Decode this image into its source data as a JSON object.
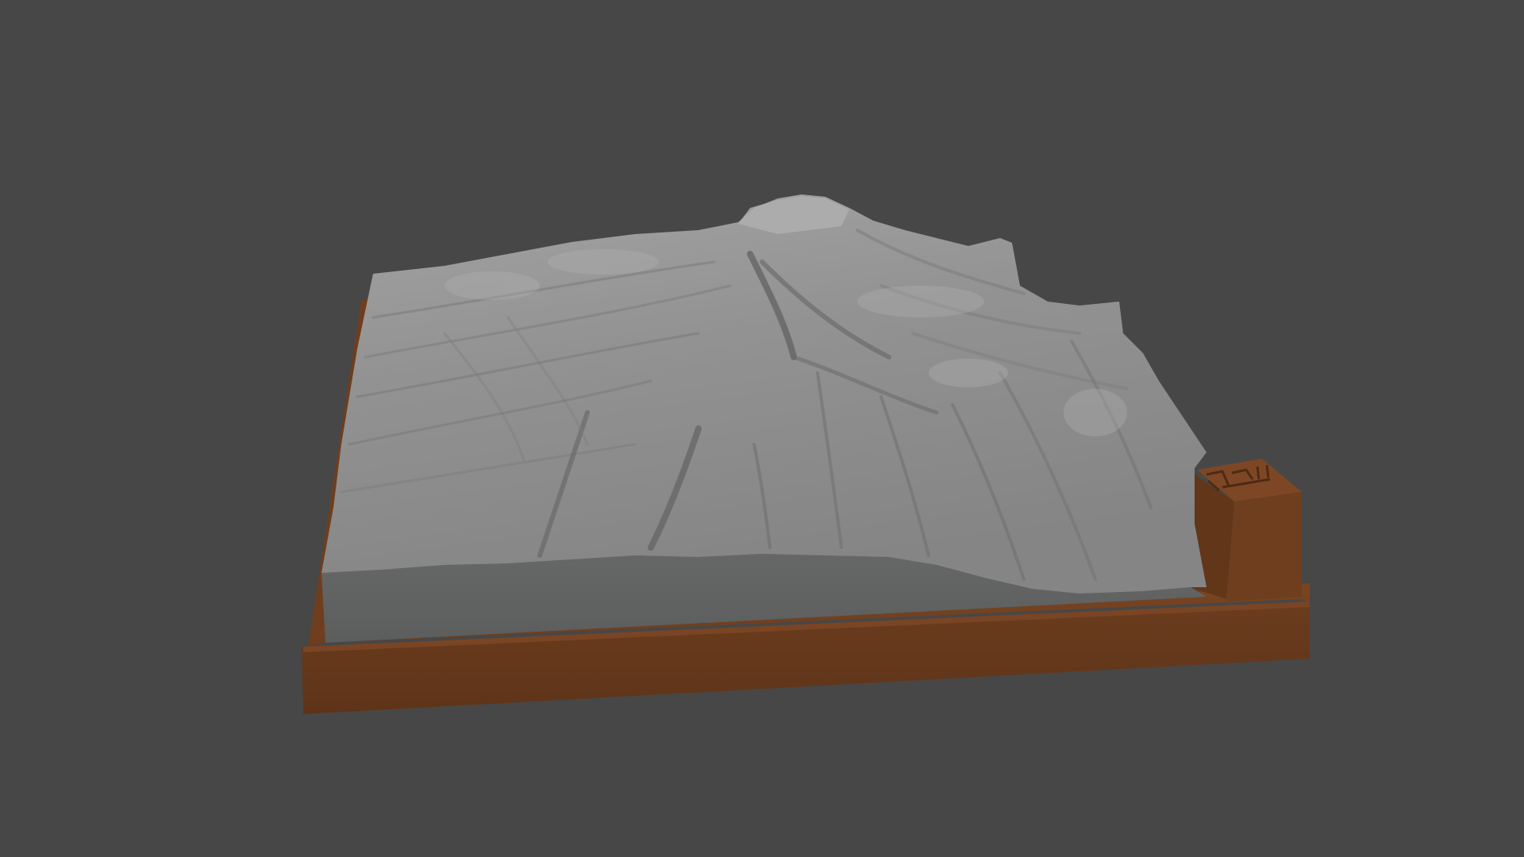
{
  "scene": {
    "background_color": "#474747",
    "model": {
      "name": "terrain-relief-model",
      "terrain_color": "#8f8f8f",
      "terrain_side_color": "#5f6060",
      "base_color": "#6b3d1f",
      "base_shadow_color": "#4f2c15"
    },
    "label_block": {
      "icon": "engraved-label-icon"
    }
  }
}
